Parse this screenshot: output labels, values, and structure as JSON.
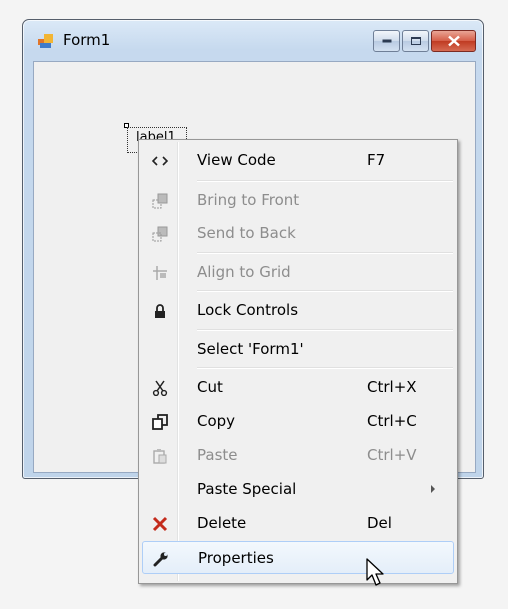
{
  "window": {
    "title": "Form1"
  },
  "label_control": {
    "text": "label1"
  },
  "menu": {
    "items": [
      {
        "id": "view-code",
        "label": "View Code",
        "shortcut": "F7",
        "icon": "code-icon",
        "enabled": true
      },
      {
        "id": "bring-to-front",
        "label": "Bring to Front",
        "shortcut": "",
        "icon": "bring-to-front-icon",
        "enabled": false
      },
      {
        "id": "send-to-back",
        "label": "Send to Back",
        "shortcut": "",
        "icon": "send-to-back-icon",
        "enabled": false
      },
      {
        "id": "align-to-grid",
        "label": "Align to Grid",
        "shortcut": "",
        "icon": "align-grid-icon",
        "enabled": false
      },
      {
        "id": "lock-controls",
        "label": "Lock Controls",
        "shortcut": "",
        "icon": "lock-icon",
        "enabled": true
      },
      {
        "id": "select-form1",
        "label": "Select 'Form1'",
        "shortcut": "",
        "icon": "",
        "enabled": true
      },
      {
        "id": "cut",
        "label": "Cut",
        "shortcut": "Ctrl+X",
        "icon": "scissors-icon",
        "enabled": true
      },
      {
        "id": "copy",
        "label": "Copy",
        "shortcut": "Ctrl+C",
        "icon": "copy-icon",
        "enabled": true
      },
      {
        "id": "paste",
        "label": "Paste",
        "shortcut": "Ctrl+V",
        "icon": "paste-icon",
        "enabled": false
      },
      {
        "id": "paste-special",
        "label": "Paste Special",
        "shortcut": "",
        "icon": "",
        "enabled": true,
        "submenu": true
      },
      {
        "id": "delete",
        "label": "Delete",
        "shortcut": "Del",
        "icon": "delete-x-icon",
        "enabled": true
      },
      {
        "id": "properties",
        "label": "Properties",
        "shortcut": "",
        "icon": "wrench-icon",
        "enabled": true,
        "highlighted": true
      }
    ]
  },
  "colors": {
    "delete_icon": "#c42b1c",
    "menu_hover_border": "#aecef7",
    "close_button": "#c03b22"
  }
}
